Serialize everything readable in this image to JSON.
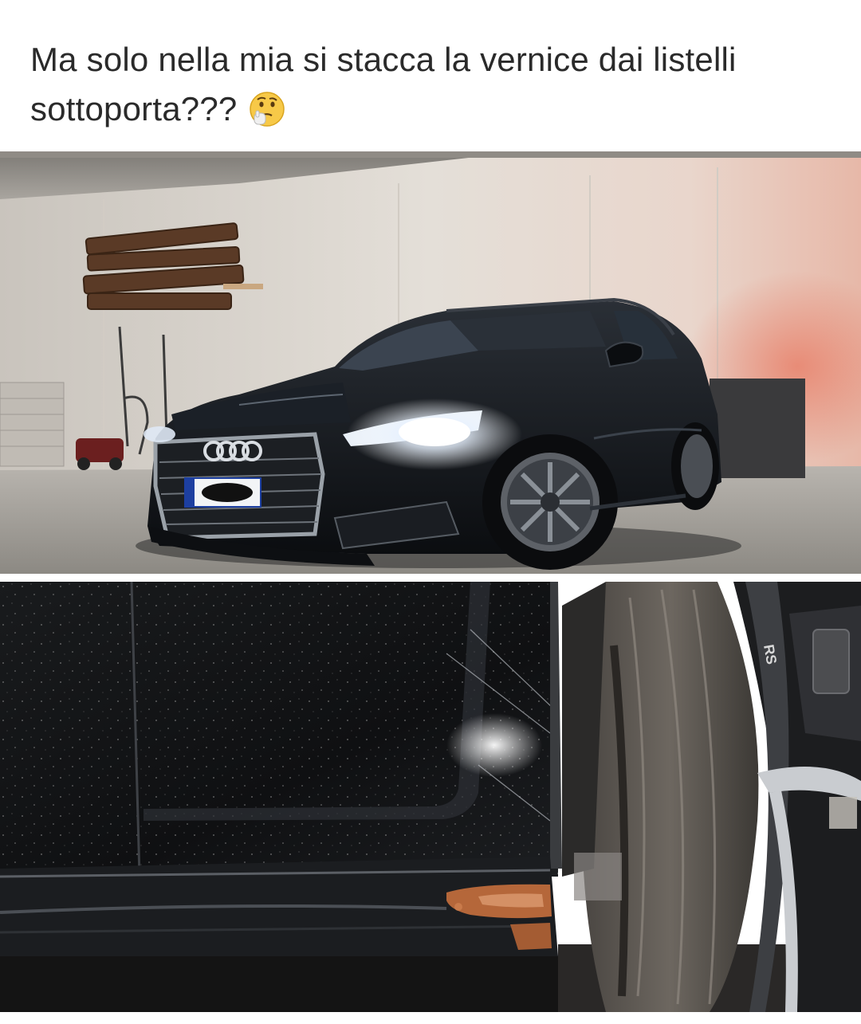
{
  "post": {
    "caption": "Ma solo nella mia si stacca la vernice dai listelli sottoporta???",
    "caption_emoji": "thinking-face-emoji"
  },
  "photos": [
    {
      "id": "car-in-garage",
      "subject": "dark station wagon in a garage with headlights on"
    },
    {
      "id": "side-skirt-closeup",
      "subject": "close-up of side skirt with peeling paint and rust next to rear wheel"
    }
  ],
  "colors": {
    "background": "#ffffff",
    "caption_text": "#2a2a2a",
    "car_body": "#111418",
    "rust": "#b5673a"
  }
}
